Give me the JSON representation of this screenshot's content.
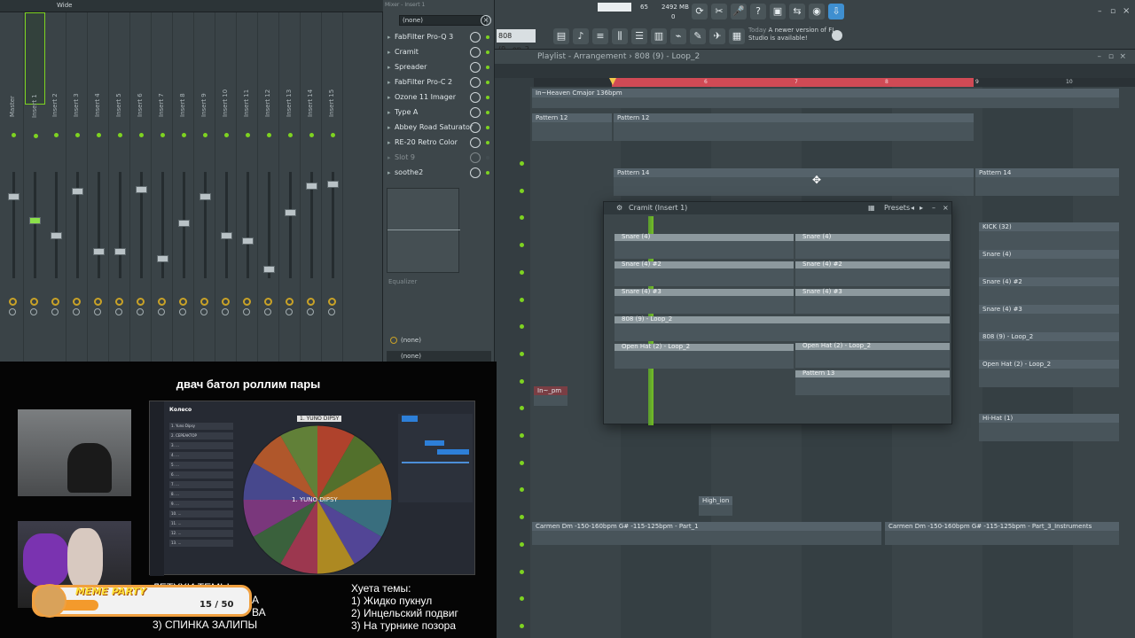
{
  "mixer": {
    "top_label": "Wide",
    "strips": [
      "Master",
      "Insert 1",
      "Insert 2",
      "Insert 3",
      "Insert 4",
      "Insert 5",
      "Insert 6",
      "Insert 7",
      "Insert 8",
      "Insert 9",
      "Insert 10",
      "Insert 11",
      "Insert 12",
      "Insert 13",
      "Insert 14",
      "Insert 15"
    ]
  },
  "insert_panel": {
    "title": "Mixer - Insert 1",
    "preset": "(none)",
    "slots": [
      "FabFilter Pro-Q 3",
      "Cramit",
      "Spreader",
      "FabFilter Pro-C 2",
      "Ozone 11 Imager",
      "Type A",
      "Abbey Road Saturator",
      "RE-20 Retro Color",
      "Slot 9",
      "soothe2"
    ],
    "eq_label": "Equalizer",
    "bottom_1": "(none)",
    "bottom_2": "(none)"
  },
  "toolbar": {
    "pattern": "808 (9...op_2",
    "cpu": "65",
    "mem": "2492 MB",
    "poly": "0",
    "news_today": "Today",
    "news_text": "A newer version of FL Studio is available!"
  },
  "playlist": {
    "breadcrumb": "Playlist - Arrangement › 808 (9) - Loop_2",
    "ruler": [
      "6",
      "7",
      "8",
      "9",
      "10"
    ],
    "clips": {
      "heaven": "In~Heaven Cmajor 136bpm",
      "pattern12a": "Pattern 12",
      "pattern12b": "Pattern 12",
      "pattern14a": "Pattern 14",
      "pattern14b": "Pattern 14",
      "kick": "KICK (32)",
      "snare": "Snare (4)",
      "snare2": "Snare (4) #2",
      "snare3": "Snare (4) #3",
      "eight": "808 (9) - Loop_2",
      "openhat": "Open Hat (2) - Loop_2",
      "hihat": "Hi-Hat (1)",
      "in_pm": "In~_pm",
      "high": "High_ion",
      "carmen1": "Carmen Dm -150-160bpm G# -115-125bpm - Part_1",
      "carmen2": "Carmen Dm -150-160bpm G# -115-125bpm - Part_3_Instruments"
    }
  },
  "cramit_window": {
    "title": "Cramit (Insert 1)",
    "presets": "Presets",
    "clips_left": [
      "Snare (4)",
      "Snare (4) #2",
      "Snare (4) #3",
      "808 (9) - Loop_2",
      "Open Hat (2) - Loop_2"
    ],
    "clips_right": [
      "Snare (4)",
      "Snare (4) #2",
      "Snare (4) #3",
      "Open Hat (2) - Loop_2",
      "Pattern 13"
    ]
  },
  "stream": {
    "title": "двач батол роллим пары",
    "wheel_header": "Колесо",
    "wheel_center": "1. YUNO DIPSY",
    "wheel_top_label": "1. YUNO DIPSY",
    "rules_left_title": "ЛЕТУХИ ТЕМЫ:",
    "rules_left_line2": "А",
    "rules_left_line3": "ВА",
    "rules_left_line4": "3) СПИНКА ЗАЛИПЫ",
    "rules_right_title": "Хуета темы:",
    "rules_right": [
      "1) Жидко пукнул",
      "2) Инцельский подвиг",
      "3) На турнике позора"
    ],
    "meme_title": "MEME PARTY",
    "meme_count": "15 / 50",
    "wheel_list": [
      "1. Yuno Dipsy",
      "2. СЕРЕАКТОР",
      "3. ...",
      "4. ...",
      "5. ...",
      "6. ...",
      "7. ...",
      "8. ...",
      "9. ...",
      "10. ...",
      "11. ...",
      "12. ...",
      "13. ..."
    ]
  }
}
